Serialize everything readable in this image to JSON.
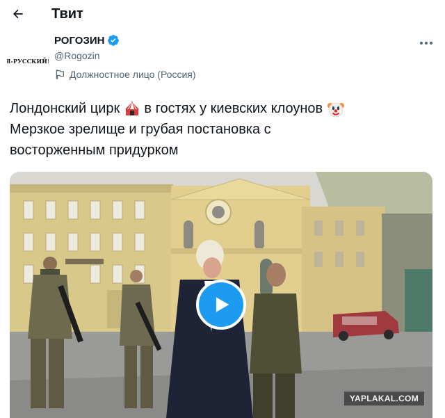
{
  "header": {
    "title": "Твит",
    "back_icon": "arrow-left-icon"
  },
  "author": {
    "avatar_text": "Я-РУССКИЙ!",
    "name": "РОГОЗИН",
    "verified_icon": "verified-badge-icon",
    "handle": "@Rogozin",
    "label_icon": "government-flag-icon",
    "label": "Должностное лицо (Россия)"
  },
  "tweet": {
    "line1_part1": "Лондонский цирк",
    "line1_part2": "в гостях у киевских клоунов",
    "line2": "Мерзкое зрелище и грубая постановка с",
    "line3": "восторженным придурком",
    "emoji_circus": "circus-tent-emoji",
    "emoji_clown": "clown-face-emoji"
  },
  "media": {
    "play_icon": "play-icon",
    "watermark": "YAPLAKAL.COM"
  },
  "colors": {
    "accent": "#1d9bf0",
    "text": "#0f1419",
    "secondary": "#536471"
  }
}
